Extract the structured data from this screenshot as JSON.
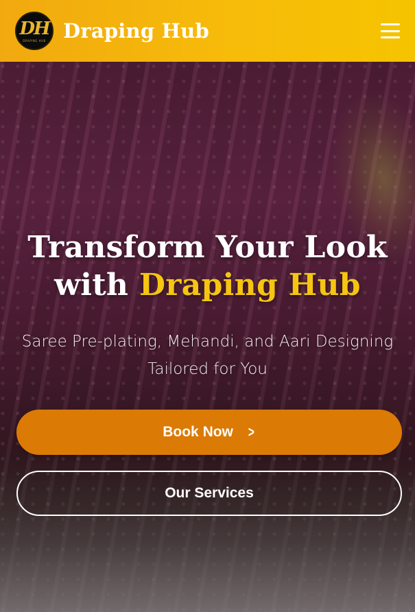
{
  "header": {
    "logo_mark": "DH",
    "logo_sub": "DRAPING HUB",
    "brand": "Draping Hub",
    "menu_icon": "hamburger-menu-icon"
  },
  "hero": {
    "headline_line1": "Transform Your Look",
    "headline_line2_prefix": "with ",
    "headline_line2_accent": "Draping Hub",
    "subtitle": "Saree Pre-plating, Mehandi, and Aari Designing Tailored for You",
    "primary_button": "Book Now",
    "primary_button_icon": "chevron-right-icon",
    "secondary_button": "Our Services"
  },
  "colors": {
    "header_bg": "#f5b80c",
    "accent_text": "#f5c511",
    "primary_button": "#dc7a06",
    "text": "#ffffff"
  }
}
